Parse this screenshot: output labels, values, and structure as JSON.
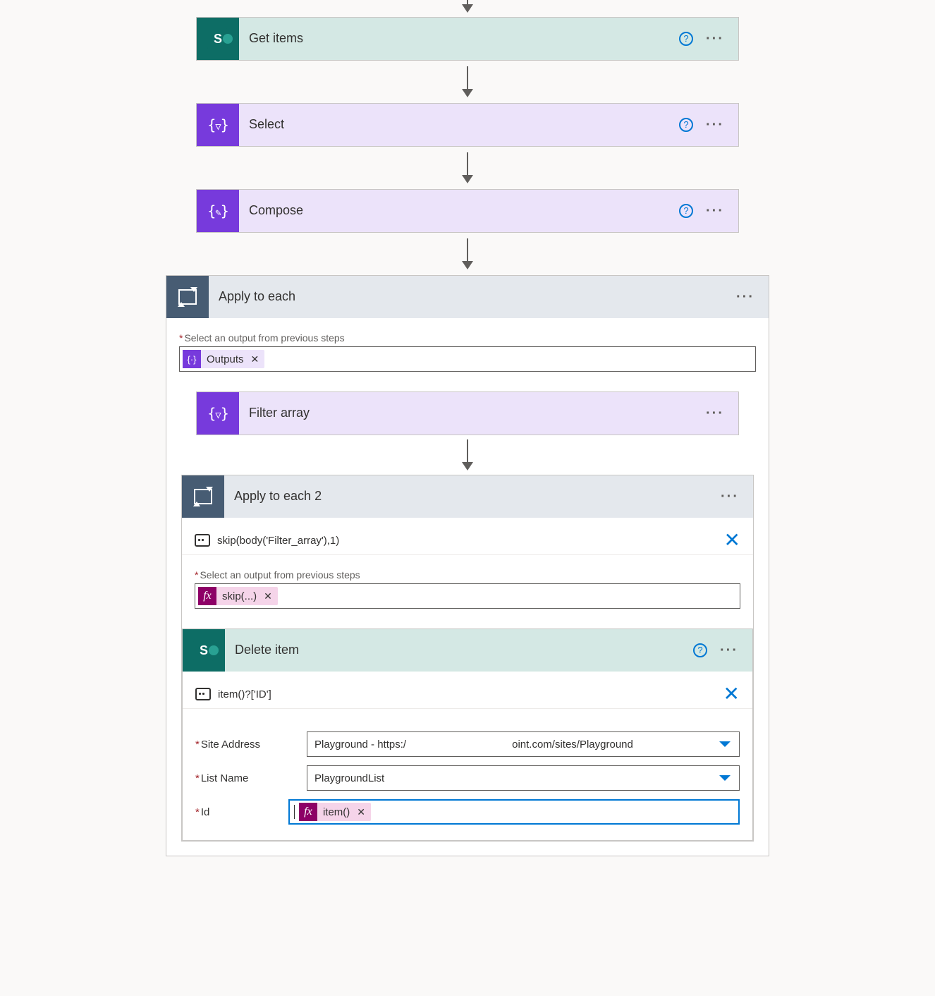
{
  "steps": {
    "getItems": {
      "title": "Get items"
    },
    "select": {
      "title": "Select"
    },
    "compose": {
      "title": "Compose"
    },
    "applyEach": {
      "title": "Apply to each",
      "outputLabel": "Select an output from previous steps",
      "tokenLabel": "Outputs"
    },
    "filter": {
      "title": "Filter array"
    },
    "applyEach2": {
      "title": "Apply to each 2",
      "peek": "skip(body('Filter_array'),1)",
      "outputLabel": "Select an output from previous steps",
      "tokenLabel": "skip(...)"
    },
    "deleteItem": {
      "title": "Delete item",
      "peek": "item()?['ID']",
      "siteLabel": "Site Address",
      "siteValue": "Playground - https:/                                    oint.com/sites/Playground",
      "listLabel": "List Name",
      "listValue": "PlaygroundList",
      "idLabel": "Id",
      "idTokenLabel": "item()"
    }
  },
  "glyphs": {
    "help": "?",
    "x": "✕",
    "fx": "fx"
  }
}
